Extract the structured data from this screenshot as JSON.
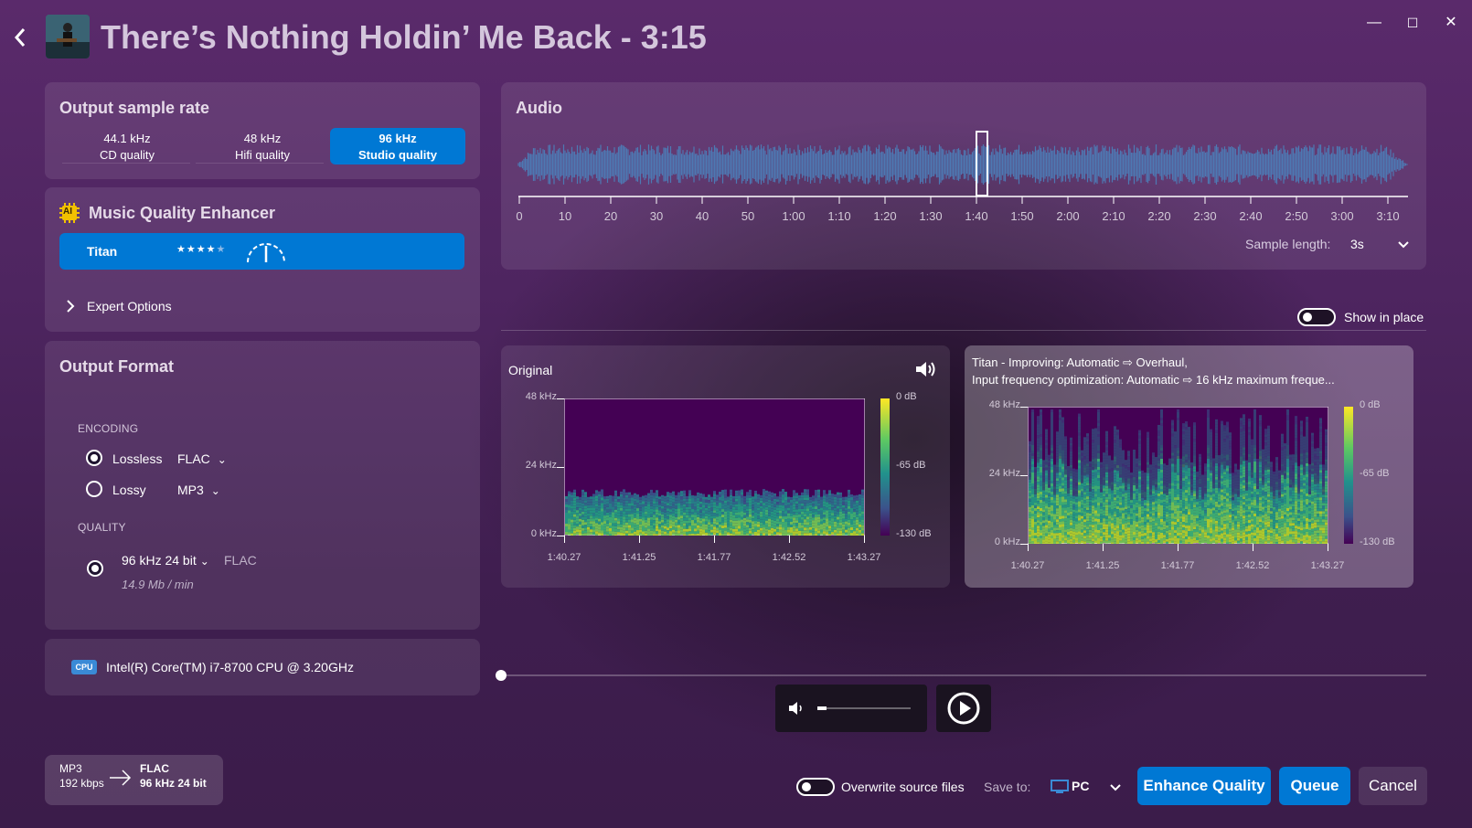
{
  "header": {
    "title": "There’s Nothing Holdin’ Me Back - 3:15",
    "window_controls": [
      "—",
      "☐",
      "✕"
    ]
  },
  "sample_rate": {
    "title": "Output sample rate",
    "options": [
      {
        "value": "44.1 kHz",
        "desc": "CD quality",
        "selected": false
      },
      {
        "value": "48 kHz",
        "desc": "Hifi quality",
        "selected": false
      },
      {
        "value": "96 kHz",
        "desc": "Studio quality",
        "selected": true
      }
    ]
  },
  "enhancer": {
    "title": "Music Quality Enhancer",
    "badge": "AI",
    "model": "Titan",
    "rating_stars": 4,
    "rating_max": 5,
    "expert_label": "Expert Options"
  },
  "output_format": {
    "title": "Output Format",
    "encoding_label": "ENCODING",
    "lossless_label": "Lossless",
    "lossless_codec": "FLAC",
    "lossy_label": "Lossy",
    "lossy_codec": "MP3",
    "quality_label": "QUALITY",
    "quality_value": "96 kHz 24 bit",
    "quality_codec": "FLAC",
    "quality_rate": "14.9 Mb / min"
  },
  "cpu": {
    "badge": "CPU",
    "name": "Intel(R) Core(TM) i7-8700 CPU @ 3.20GHz"
  },
  "conversion": {
    "from_format": "MP3",
    "from_detail": "192 kbps",
    "to_format": "FLAC",
    "to_detail": "96 kHz 24 bit"
  },
  "audio": {
    "title": "Audio",
    "timeline_ticks": [
      "0",
      "10",
      "20",
      "30",
      "40",
      "50",
      "1:00",
      "1:10",
      "1:20",
      "1:30",
      "1:40",
      "1:50",
      "2:00",
      "2:10",
      "2:20",
      "2:30",
      "2:40",
      "2:50",
      "3:00",
      "3:10"
    ],
    "selection_start_label": "1:40",
    "sample_length_label": "Sample length:",
    "sample_length_value": "3s",
    "show_in_place_label": "Show in place"
  },
  "original_spec": {
    "title": "Original",
    "freq_labels": [
      "48 kHz",
      "24 kHz",
      "0 kHz"
    ],
    "db_labels": [
      "0 dB",
      "-65 dB",
      "-130 dB"
    ],
    "time_labels": [
      "1:40.27",
      "1:41.25",
      "1:41.77",
      "1:42.52",
      "1:43.27"
    ]
  },
  "enhanced_spec": {
    "title_line1": "Titan - Improving: Automatic ⇨ Overhaul,",
    "title_line2": "Input frequency optimization: Automatic ⇨ 16 kHz maximum freque...",
    "freq_labels": [
      "48 kHz",
      "24 kHz",
      "0 kHz"
    ],
    "db_labels": [
      "0 dB",
      "-65 dB",
      "-130 dB"
    ],
    "time_labels": [
      "1:40.27",
      "1:41.25",
      "1:41.77",
      "1:42.52",
      "1:43.27"
    ]
  },
  "footer": {
    "overwrite_label": "Overwrite source files",
    "save_to_label": "Save to:",
    "save_to_value": "PC",
    "enhance_label": "Enhance Quality",
    "queue_label": "Queue",
    "cancel_label": "Cancel"
  },
  "playback": {
    "volume_level": 0.1,
    "progress": 0
  },
  "colors": {
    "accent": "#0078d4",
    "waveform": "#4d79b3"
  }
}
